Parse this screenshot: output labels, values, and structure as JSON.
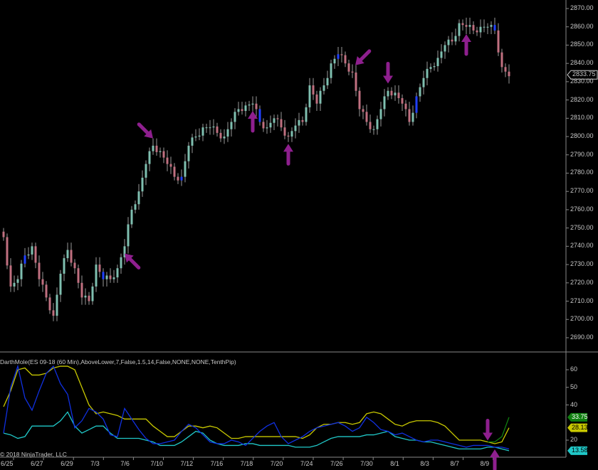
{
  "indicator_title": "DarthMole(ES 09-18 (60 Min),AboveLower,7,False,1.5,14,False,NONE,NONE,TenthPip)",
  "copyright": "© 2018 NinjaTrader, LLC",
  "colors": {
    "up": "#7fbfb0",
    "down": "#c07080",
    "highlight": "#2040ff",
    "arrow": "#8e1f8e",
    "yellow": "#c8c800",
    "cyan": "#20c8c8",
    "blue": "#1030e0",
    "green": "#108010",
    "red": "#d02010"
  },
  "chart_data": [
    {
      "type": "candlestick",
      "title": "ES 09-18 (60 Min)",
      "ylim": [
        2685,
        2872
      ],
      "yticks": [
        "2870.00",
        "2860.00",
        "2850.00",
        "2840.00",
        "2830.00",
        "2820.00",
        "2810.00",
        "2800.00",
        "2790.00",
        "2780.00",
        "2770.00",
        "2760.00",
        "2750.00",
        "2740.00",
        "2730.00",
        "2720.00",
        "2710.00",
        "2700.00",
        "2690.00"
      ],
      "last_price_label": "2833.75",
      "last_price": 2833.75,
      "closes": [
        2745,
        2718,
        2722,
        2735,
        2740,
        2722,
        2712,
        2702,
        2725,
        2738,
        2728,
        2712,
        2710,
        2730,
        2722,
        2722,
        2728,
        2740,
        2760,
        2770,
        2785,
        2795,
        2792,
        2785,
        2778,
        2778,
        2795,
        2800,
        2805,
        2805,
        2802,
        2800,
        2808,
        2815,
        2817,
        2818,
        2808,
        2805,
        2810,
        2805,
        2800,
        2806,
        2808,
        2828,
        2818,
        2828,
        2840,
        2845,
        2840,
        2835,
        2815,
        2808,
        2804,
        2815,
        2825,
        2824,
        2818,
        2808,
        2822,
        2832,
        2838,
        2843,
        2850,
        2852,
        2862,
        2860,
        2858,
        2860,
        2860,
        2858,
        2838,
        2833
      ],
      "annotation_arrows": [
        {
          "bar": 17,
          "dir": "up-left"
        },
        {
          "bar": 21,
          "dir": "down-right"
        },
        {
          "bar": 35,
          "dir": "up"
        },
        {
          "bar": 40,
          "dir": "up"
        },
        {
          "bar": 49,
          "dir": "down-left"
        },
        {
          "bar": 54,
          "dir": "down"
        },
        {
          "bar": 65,
          "dir": "up"
        }
      ]
    },
    {
      "type": "line",
      "title": "DarthMole",
      "ylim": [
        12,
        68
      ],
      "yticks": [
        "60",
        "50",
        "40",
        "20"
      ],
      "x_labels": [
        "6/25",
        "6/27",
        "6/29",
        "7/3",
        "7/6",
        "7/10",
        "7/12",
        "7/16",
        "7/18",
        "7/20",
        "7/24",
        "7/26",
        "7/30",
        "8/1",
        "8/3",
        "8/7",
        "8/9"
      ],
      "series": [
        {
          "name": "yellow",
          "color": "#c8c800",
          "label": "28.13",
          "values": [
            39,
            48,
            60,
            61,
            57,
            57,
            58,
            61,
            62,
            62,
            60,
            50,
            40,
            35,
            36,
            35,
            34,
            32,
            32,
            32,
            32,
            28,
            25,
            22,
            22,
            25,
            28,
            28,
            27,
            28,
            27,
            24,
            21,
            21,
            22,
            22,
            22,
            22,
            22,
            22,
            22,
            22,
            21,
            23,
            27,
            29,
            29,
            30,
            30,
            29,
            30,
            35,
            36,
            35,
            32,
            29,
            28,
            30,
            31,
            31,
            31,
            30,
            28,
            24,
            20,
            20,
            20,
            20,
            19,
            18,
            19,
            27
          ]
        },
        {
          "name": "cyan",
          "color": "#20c8c8",
          "label": "13.58",
          "values": [
            24,
            23,
            21,
            22,
            28,
            28,
            28,
            28,
            31,
            36,
            28,
            24,
            26,
            28,
            28,
            24,
            21,
            21,
            21,
            21,
            20,
            19,
            17,
            17,
            17,
            19,
            22,
            25,
            24,
            20,
            18,
            17,
            17,
            17,
            18,
            18,
            17,
            17,
            17,
            17,
            17,
            16,
            16,
            16,
            17,
            19,
            21,
            22,
            22,
            22,
            22,
            23,
            23,
            24,
            25,
            22,
            21,
            20,
            20,
            19,
            19,
            18,
            17,
            16,
            15,
            15,
            15,
            15,
            16,
            16,
            15,
            14
          ]
        },
        {
          "name": "blue",
          "color": "#1030e0",
          "values": [
            24,
            50,
            62,
            44,
            37,
            48,
            58,
            62,
            52,
            46,
            27,
            31,
            38,
            36,
            32,
            23,
            22,
            38,
            32,
            26,
            21,
            18,
            18,
            19,
            20,
            25,
            29,
            27,
            23,
            19,
            18,
            18,
            20,
            19,
            17,
            21,
            25,
            28,
            30,
            22,
            18,
            20,
            22,
            25,
            27,
            28,
            29,
            30,
            28,
            25,
            27,
            33,
            30,
            26,
            25,
            23,
            24,
            22,
            20,
            19,
            20,
            20,
            19,
            18,
            17,
            16,
            17,
            17,
            17,
            16,
            16,
            15
          ]
        },
        {
          "name": "green",
          "color": "#108010",
          "label": "33.75",
          "values": [
            null,
            null,
            null,
            null,
            null,
            null,
            null,
            null,
            null,
            null,
            null,
            null,
            null,
            null,
            null,
            null,
            null,
            null,
            null,
            null,
            null,
            null,
            null,
            null,
            null,
            null,
            null,
            null,
            null,
            null,
            null,
            null,
            null,
            null,
            null,
            null,
            null,
            null,
            null,
            null,
            null,
            null,
            null,
            null,
            null,
            null,
            null,
            null,
            null,
            null,
            null,
            null,
            null,
            null,
            null,
            null,
            null,
            null,
            null,
            null,
            null,
            null,
            null,
            null,
            null,
            null,
            null,
            null,
            19,
            19,
            22,
            33
          ]
        }
      ],
      "annotation_arrows": [
        {
          "bar": 68,
          "dir": "down"
        },
        {
          "bar": 69,
          "dir": "up"
        }
      ]
    }
  ]
}
